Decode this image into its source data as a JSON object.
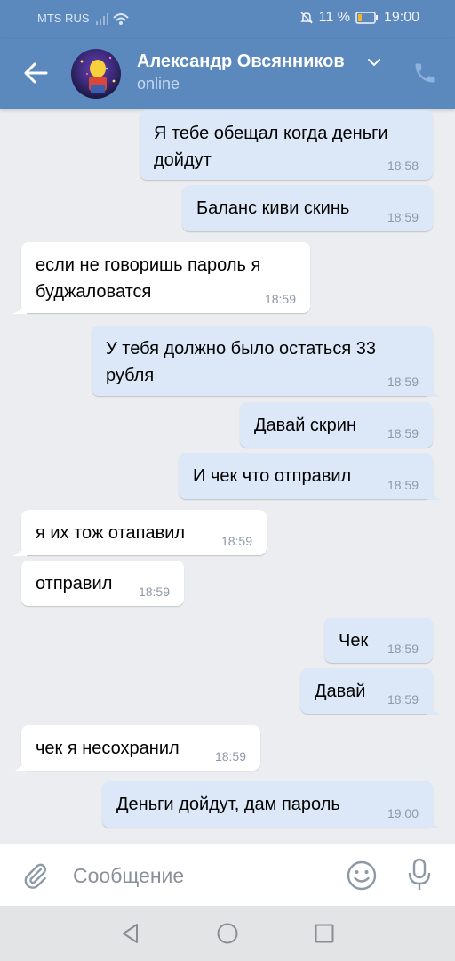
{
  "status_bar": {
    "carrier": "MTS RUS",
    "battery": "11 %",
    "time": "19:00"
  },
  "header": {
    "contact_name": "Александр Овсянников",
    "presence": "online"
  },
  "messages": [
    {
      "direction": "out",
      "text_lines": [
        "Я тебе обещал когда деньги",
        "дойдут"
      ],
      "time": "18:58"
    },
    {
      "direction": "out",
      "text_lines": [
        "Баланс киви скинь"
      ],
      "time": "18:59"
    },
    {
      "direction": "in",
      "text_lines": [
        "если не говоришь пароль я",
        "буджаловатся"
      ],
      "time": "18:59"
    },
    {
      "direction": "out",
      "text_lines": [
        "У тебя должно было остаться 33",
        "рубля"
      ],
      "time": "18:59"
    },
    {
      "direction": "out",
      "text_lines": [
        "Давай скрин"
      ],
      "time": "18:59"
    },
    {
      "direction": "out",
      "text_lines": [
        "И чек что отправил"
      ],
      "time": "18:59"
    },
    {
      "direction": "in",
      "text_lines": [
        "я их тож отапавил"
      ],
      "time": "18:59"
    },
    {
      "direction": "in",
      "text_lines": [
        "отправил"
      ],
      "time": "18:59"
    },
    {
      "direction": "out",
      "text_lines": [
        "Чек"
      ],
      "time": "18:59"
    },
    {
      "direction": "out",
      "text_lines": [
        "Давай"
      ],
      "time": "18:59"
    },
    {
      "direction": "in",
      "text_lines": [
        "чек я несохранил"
      ],
      "time": "18:59"
    },
    {
      "direction": "out",
      "text_lines": [
        "Деньги дойдут, дам пароль"
      ],
      "time": "19:00"
    }
  ],
  "composer": {
    "placeholder": "Сообщение"
  },
  "icons": {
    "back": "arrow-left-icon",
    "call": "phone-icon",
    "attach": "paperclip-icon",
    "emoji": "smiley-icon",
    "voice": "microphone-icon",
    "nav_back": "triangle-back-icon",
    "nav_home": "circle-home-icon",
    "nav_recents": "square-recents-icon"
  },
  "colors": {
    "header": "#5b88bd",
    "outgoing_bubble": "#dce8f8",
    "incoming_bubble": "#ffffff",
    "chat_background": "#ebedf0"
  }
}
